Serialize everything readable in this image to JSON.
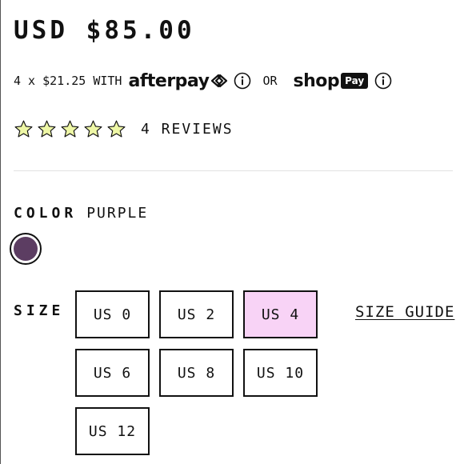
{
  "price": "USD $85.00",
  "installments": {
    "text": "4 x $21.25 WITH",
    "afterpay_label": "afterpay",
    "or_text": "OR",
    "shop_label": "shop",
    "pay_label": "Pay",
    "icons": [
      "afterpay-arrows-icon",
      "info-icon",
      "info-icon"
    ]
  },
  "rating": {
    "stars": 5,
    "icon": "star-icon",
    "star_fill_color": "#eef7a6",
    "reviews_label": "4 REVIEWS"
  },
  "color": {
    "label": "COLOR",
    "value": "PURPLE",
    "swatch_color": "#5c3d62"
  },
  "size": {
    "label": "SIZE",
    "options": [
      "US 0",
      "US 2",
      "US 4",
      "US 6",
      "US 8",
      "US 10",
      "US 12"
    ],
    "selected": "US 4",
    "selected_color": "#f8d3f6",
    "guide_label": "SIZE GUIDE"
  }
}
